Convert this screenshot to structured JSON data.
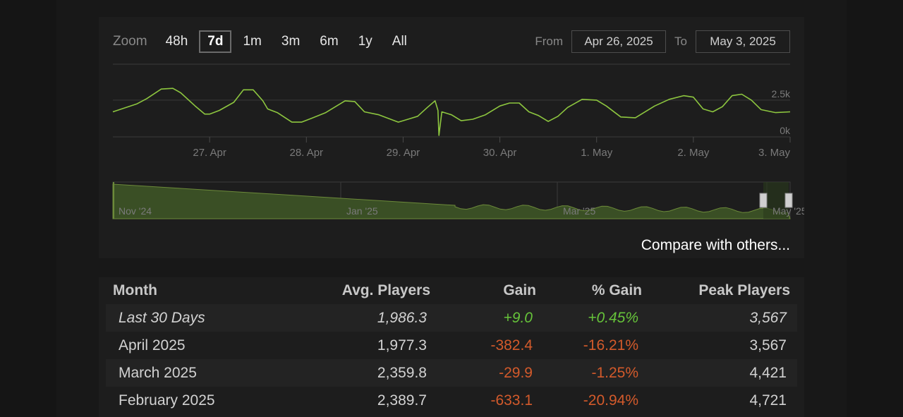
{
  "zoom": {
    "label": "Zoom",
    "options": [
      "48h",
      "7d",
      "1m",
      "3m",
      "6m",
      "1y",
      "All"
    ],
    "active": "7d"
  },
  "range": {
    "from_label": "From",
    "from_value": "Apr 26, 2025",
    "to_label": "To",
    "to_value": "May 3, 2025"
  },
  "compare_link": "Compare with others...",
  "colors": {
    "line": "#8dc63f",
    "navigator_fill": "#3a4f25",
    "positive": "#66c33a",
    "negative": "#d35a2b"
  },
  "chart_data": [
    {
      "type": "line",
      "name": "main-chart",
      "x_ticks": [
        "27. Apr",
        "28. Apr",
        "29. Apr",
        "30. Apr",
        "1. May",
        "2. May",
        "3. May"
      ],
      "y_ticks": [
        "0k",
        "2.5k"
      ],
      "ylim": [
        0,
        3500
      ],
      "x_days_start": "Apr 26, 2025",
      "x": [
        0,
        0.25,
        0.35,
        0.5,
        0.62,
        0.7,
        0.85,
        0.95,
        1.0,
        1.1,
        1.25,
        1.35,
        1.45,
        1.55,
        1.6,
        1.7,
        1.85,
        1.95,
        2.05,
        2.2,
        2.4,
        2.5,
        2.6,
        2.75,
        2.95,
        3.05,
        3.15,
        3.25,
        3.33,
        3.36,
        3.37,
        3.4,
        3.5,
        3.6,
        3.72,
        3.85,
        4.0,
        4.1,
        4.2,
        4.3,
        4.4,
        4.5,
        4.6,
        4.7,
        4.85,
        5.0,
        5.1,
        5.25,
        5.4,
        5.6,
        5.75,
        5.9,
        6.0,
        6.1,
        6.2,
        6.3,
        6.4,
        6.5,
        6.6,
        6.7,
        6.85,
        7.0
      ],
      "y": [
        1700,
        2250,
        2600,
        3250,
        3300,
        3000,
        2100,
        1550,
        1550,
        1800,
        2350,
        3200,
        3200,
        2450,
        1900,
        1650,
        1000,
        1000,
        1250,
        1650,
        2450,
        2400,
        1700,
        1500,
        1000,
        1200,
        1400,
        2000,
        2450,
        1800,
        100,
        1700,
        1500,
        1100,
        1200,
        1500,
        2100,
        2300,
        2300,
        1700,
        1450,
        1050,
        1400,
        2000,
        2550,
        2500,
        2100,
        1350,
        1300,
        2100,
        2550,
        2800,
        2700,
        1900,
        1700,
        2050,
        2800,
        2900,
        2500,
        1850,
        1650,
        1700
      ]
    },
    {
      "type": "area",
      "name": "navigator",
      "x_ticks": [
        "Nov '24",
        "Jan '25",
        "Mar '25",
        "May '25"
      ]
    }
  ],
  "table": {
    "headers": [
      "Month",
      "Avg. Players",
      "Gain",
      "% Gain",
      "Peak Players"
    ],
    "rows": [
      {
        "month": "Last 30 Days",
        "avg": "1,986.3",
        "gain": "+9.0",
        "pct": "+0.45%",
        "peak": "3,567",
        "sign": "pos",
        "italic": true
      },
      {
        "month": "April 2025",
        "avg": "1,977.3",
        "gain": "-382.4",
        "pct": "-16.21%",
        "peak": "3,567",
        "sign": "neg",
        "italic": false
      },
      {
        "month": "March 2025",
        "avg": "2,359.8",
        "gain": "-29.9",
        "pct": "-1.25%",
        "peak": "4,421",
        "sign": "neg",
        "italic": false
      },
      {
        "month": "February 2025",
        "avg": "2,389.7",
        "gain": "-633.1",
        "pct": "-20.94%",
        "peak": "4,721",
        "sign": "neg",
        "italic": false
      }
    ]
  }
}
